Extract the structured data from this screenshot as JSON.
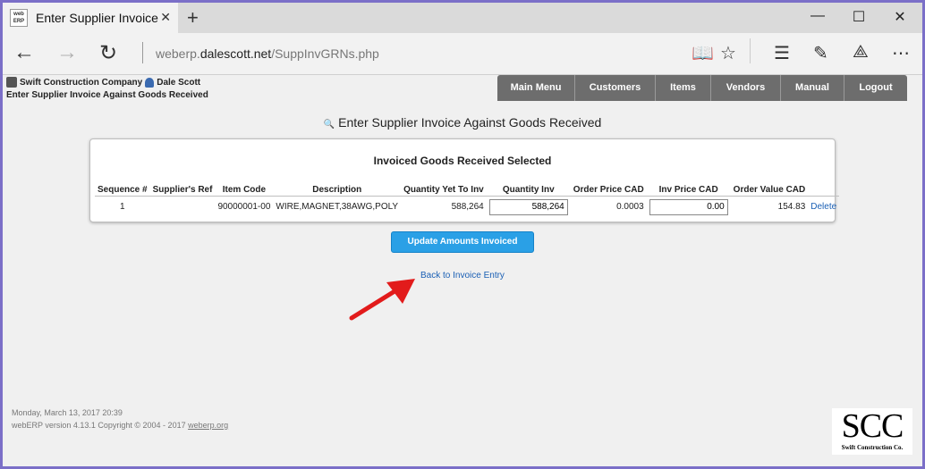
{
  "browser": {
    "tab_title": "Enter Supplier Invoice A",
    "favicon_top": "web",
    "favicon_bottom": "ERP",
    "url_prefix": "weberp.",
    "url_domain": "dalescott.net",
    "url_path": "/SuppInvGRNs.php"
  },
  "header": {
    "company": "Swift Construction Company",
    "user": "Dale Scott",
    "subtitle": "Enter Supplier Invoice Against Goods Received"
  },
  "menu": {
    "items": [
      "Main Menu",
      "Customers",
      "Items",
      "Vendors",
      "Manual",
      "Logout"
    ]
  },
  "page": {
    "title": "Enter Supplier Invoice Against Goods Received"
  },
  "panel": {
    "title": "Invoiced Goods Received Selected",
    "columns": [
      "Sequence #",
      "Supplier's Ref",
      "Item Code",
      "Description",
      "Quantity Yet To Inv",
      "Quantity Inv",
      "Order Price CAD",
      "Inv Price CAD",
      "Order Value CAD"
    ],
    "row": {
      "sequence": "1",
      "suppliers_ref": "",
      "item_code": "90000001-00",
      "description": "WIRE,MAGNET,38AWG,POLY",
      "qty_yet_to_inv": "588,264",
      "qty_inv": "588,264",
      "order_price": "0.0003",
      "inv_price": "0.00",
      "order_value": "154.83",
      "delete_label": "Delete"
    }
  },
  "actions": {
    "update_label": "Update Amounts Invoiced",
    "back_label": "Back to Invoice Entry"
  },
  "footer": {
    "date": "Monday, March 13, 2017 20:39",
    "version_prefix": "webERP version 4.13.1 Copyright © 2004 - 2017 ",
    "version_link": "weberp.org"
  },
  "logo": {
    "big": "SCC",
    "small": "Swift Construction Co."
  },
  "colors": {
    "menu_bg": "#6d6d6d",
    "button_bg": "#2aa0e6",
    "arrow": "#e21b1b",
    "link": "#1a5fb4"
  }
}
